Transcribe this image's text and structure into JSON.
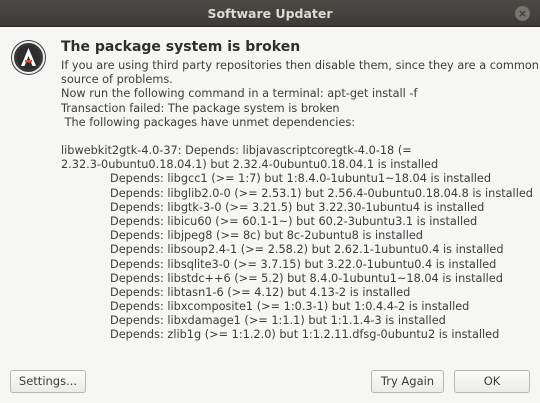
{
  "window": {
    "title": "Software Updater",
    "close_glyph": "×"
  },
  "icon": {
    "name": "software-updater-icon"
  },
  "message": {
    "heading": "The package system is broken",
    "body_lines": [
      "If you are using third party repositories then disable them, since they are a common",
      "source of problems.",
      "Now run the following command in a terminal: apt-get install -f",
      "Transaction failed: The package system is broken",
      " The following packages have unmet dependencies:"
    ]
  },
  "details": {
    "lines": [
      "libwebkit2gtk-4.0-37: Depends: libjavascriptcoregtk-4.0-18 (=",
      "2.32.3-0ubuntu0.18.04.1) but 2.32.4-0ubuntu0.18.04.1 is installed",
      "Depends: libgcc1 (>= 1:7) but 1:8.4.0-1ubuntu1~18.04 is installed",
      "Depends: libglib2.0-0 (>= 2.53.1) but 2.56.4-0ubuntu0.18.04.8 is installed",
      "Depends: libgtk-3-0 (>= 3.21.5) but 3.22.30-1ubuntu4 is installed",
      "Depends: libicu60 (>= 60.1-1~) but 60.2-3ubuntu3.1 is installed",
      "Depends: libjpeg8 (>= 8c) but 8c-2ubuntu8 is installed",
      "Depends: libsoup2.4-1 (>= 2.58.2) but 2.62.1-1ubuntu0.4 is installed",
      "Depends: libsqlite3-0 (>= 3.7.15) but 3.22.0-1ubuntu0.4 is installed",
      "Depends: libstdc++6 (>= 5.2) but 8.4.0-1ubuntu1~18.04 is installed",
      "Depends: libtasn1-6 (>= 4.12) but 4.13-2 is installed",
      "Depends: libxcomposite1 (>= 1:0.3-1) but 1:0.4.4-2 is installed",
      "Depends: libxdamage1 (>= 1:1.1) but 1:1.1.4-3 is installed",
      "Depends: zlib1g (>= 1:1.2.0) but 1:1.2.11.dfsg-0ubuntu2 is installed"
    ]
  },
  "buttons": {
    "settings": "Settings...",
    "try_again": "Try Again",
    "ok": "OK"
  },
  "colors": {
    "titlebar": "#3c3b37",
    "title_text": "#dfdbd2",
    "window_bg": "#f6f6f5",
    "icon_orange": "#e95420"
  }
}
